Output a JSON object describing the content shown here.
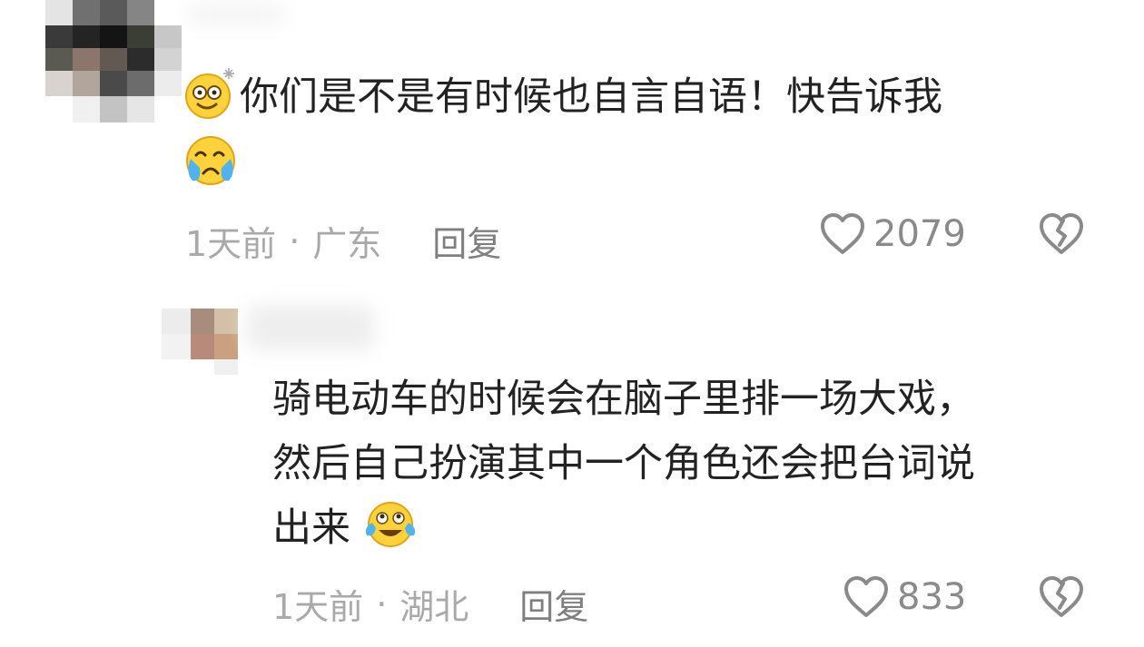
{
  "comments": [
    {
      "text": "你们是不是有时候也自言自语！快告诉我",
      "emojis": [
        "dizzy-smile-emoji",
        "crying-emoji"
      ],
      "time": "1天前",
      "separator": "·",
      "location": "广东",
      "reply_label": "回复",
      "likes": "2079"
    },
    {
      "text": "骑电动车的时候会在脑子里排一场大戏，\n然后自己扮演其中一个角色还会把台词说\n出来",
      "emojis": [
        "tears-of-joy-emoji"
      ],
      "time": "1天前",
      "separator": "·",
      "location": "湖北",
      "reply_label": "回复",
      "likes": "833"
    }
  ],
  "icons": {
    "like": "heart-outline-icon",
    "dislike": "broken-heart-icon"
  },
  "colors": {
    "text": "#222222",
    "meta": "#a9a9a9",
    "reply": "#7f7f7f",
    "icon": "#8a8a8a",
    "emoji_yellow": "#fdd23a"
  }
}
